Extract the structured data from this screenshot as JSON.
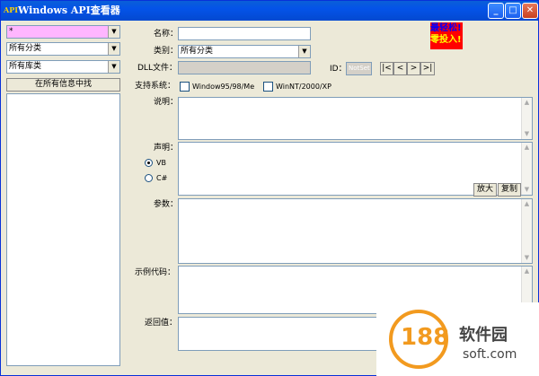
{
  "window": {
    "title": "Windows API查看器",
    "app_icon_text": "API",
    "minimize": "_",
    "maximize": "□",
    "close": "✕"
  },
  "left": {
    "search_value": "*",
    "category_value": "所有分类",
    "library_value": "所有库类",
    "search_all_button": "在所有信息中找"
  },
  "form": {
    "name_label": "名称：",
    "name_value": "",
    "category_label": "类别：",
    "category_value": "所有分类",
    "dll_label": "DLL文件：",
    "dll_value": "",
    "id_label": "ID：",
    "id_value": "NotSet",
    "nav": [
      "|<",
      "<",
      ">",
      ">|"
    ],
    "os_label": "支持系统：",
    "os_options": [
      "Window95/98/Me",
      "WinNT/2000/XP"
    ],
    "desc_label": "说明：",
    "decl_label": "声明：",
    "lang_options": [
      "VB",
      "C#"
    ],
    "zoom_button": "放大",
    "copy_button": "复制",
    "params_label": "参数：",
    "sample_label": "示例代码：",
    "return_label": "返回值："
  },
  "promo": {
    "line1": "最轻松!",
    "line2": "零投入!"
  },
  "watermark": {
    "number": "188",
    "cn": "软件园",
    "en": "soft.com"
  }
}
